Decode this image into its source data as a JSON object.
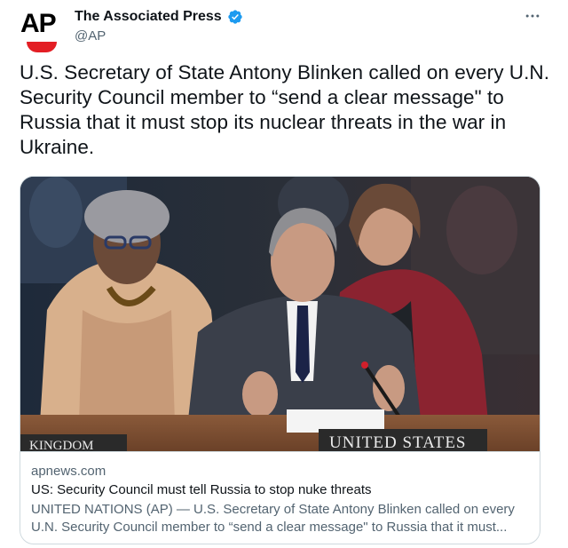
{
  "author": {
    "display_name": "The Associated Press",
    "handle": "@AP",
    "avatar_text": "AP",
    "verified": true
  },
  "tweet": {
    "text": "U.S. Secretary of State Antony Blinken called on every U.N. Security Council member to “send a clear message\" to Russia that it must stop its nuclear threats in the war in Ukraine."
  },
  "link_card": {
    "domain": "apnews.com",
    "title": "US: Security Council must tell Russia to stop nuke threats",
    "description": "UNITED NATIONS (AP) — U.S. Secretary of State Antony Blinken called on every U.N. Security Council member to “send a clear message\" to Russia that it must...",
    "photo": {
      "nameplate_text": "UNITED STATES",
      "nameplate_left_text": "KINGDOM"
    }
  },
  "icons": {
    "more": "more-options-icon",
    "verified": "verified-badge-icon"
  },
  "colors": {
    "verified_blue": "#1d9bf0",
    "ap_red": "#e31e24",
    "muted_text": "#536471",
    "border": "#cfd9de"
  }
}
